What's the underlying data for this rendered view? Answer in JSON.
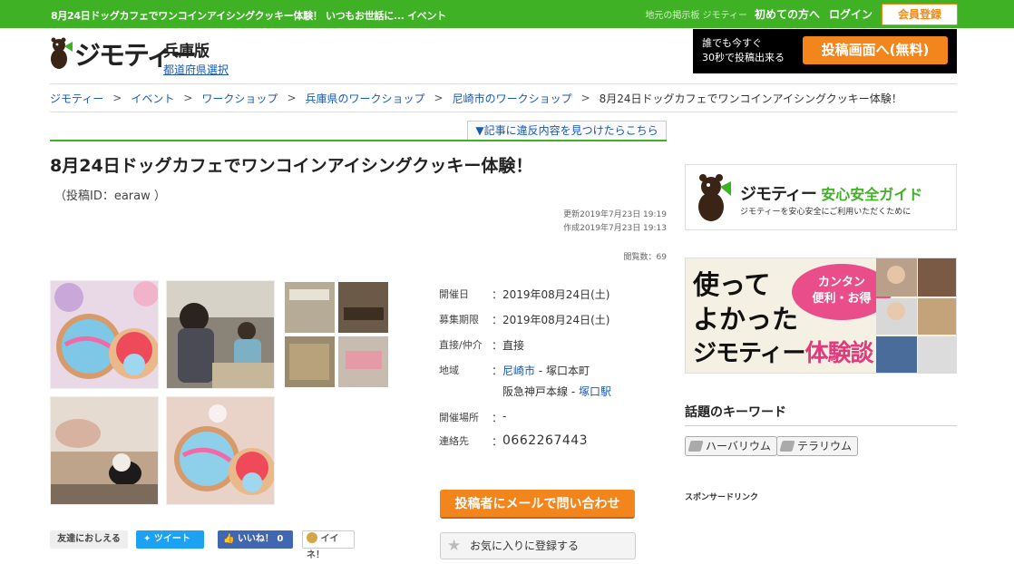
{
  "topbar": {
    "headline": "8月24日ドッグカフェでワンコインアイシングクッキー体験！ いつもお世話に... イベント",
    "site_label": "地元の掲示板 ジモティー",
    "first_time": "初めての方へ",
    "login": "ログイン",
    "register": "会員登録"
  },
  "header": {
    "brand": "ジモティー",
    "prefecture": "兵庫版",
    "prefecture_select": "都道府県選択",
    "post_promo_line1": "誰でも今すぐ",
    "post_promo_line2": "30秒で投稿出来る",
    "post_button": "投稿画面へ(無料)"
  },
  "breadcrumb": [
    {
      "label": "ジモティー"
    },
    {
      "label": "イベント"
    },
    {
      "label": "ワークショップ"
    },
    {
      "label": "兵庫県のワークショップ"
    },
    {
      "label": "尼崎市のワークショップ"
    },
    {
      "label": "8月24日ドッグカフェでワンコインアイシングクッキー体験！"
    }
  ],
  "report_link": "▼記事に違反内容を見つけたらこちら",
  "post": {
    "title": "8月24日ドッグカフェでワンコインアイシングクッキー体験！",
    "post_id": "（投稿ID：earaw ）",
    "updated": "更新2019年7月23日 19:19",
    "created": "作成2019年7月23日 19:13",
    "views": "閲覧数：69"
  },
  "details": {
    "date_label": "開催日",
    "date_value": "2019年08月24日(土)",
    "deadline_label": "募集期限",
    "deadline_value": "2019年08月24日(土)",
    "direct_label": "直接/仲介",
    "direct_value": "直接",
    "area_label": "地域",
    "area_city": "尼崎市",
    "area_rest": " - 塚口本町",
    "line_name": "阪急神戸本線",
    "line_sep": " - ",
    "station": "塚口駅",
    "venue_label": "開催場所",
    "venue_value": "-",
    "contact_label": "連絡先",
    "contact_value": "0662267443",
    "colon": "："
  },
  "actions": {
    "mail": "投稿者にメールで問い合わせ",
    "favorite": "お気に入りに登録する"
  },
  "share": {
    "tell": "友達におしえる",
    "tweet": "ツイート",
    "like": "いいね！ 0",
    "mixi": "イイネ！"
  },
  "sidebar": {
    "guide_brand": "ジモティー",
    "guide_title": "安心安全ガイド",
    "guide_sub": "ジモティーを安心安全にご利用いただくために",
    "banner_line1": "使って",
    "banner_line2": "よかった",
    "banner_brand": "ジモティー",
    "banner_suffix": "体験談",
    "banner_bubble1": "カンタン",
    "banner_bubble2": "便利・お得",
    "keywords_title": "話題のキーワード",
    "keywords": [
      "ハーバリウム",
      "テラリウム"
    ],
    "sponsor": "スポンサードリンク"
  },
  "colors": {
    "green": "#3fb125",
    "orange": "#f3851d",
    "link": "#1a58b3"
  }
}
